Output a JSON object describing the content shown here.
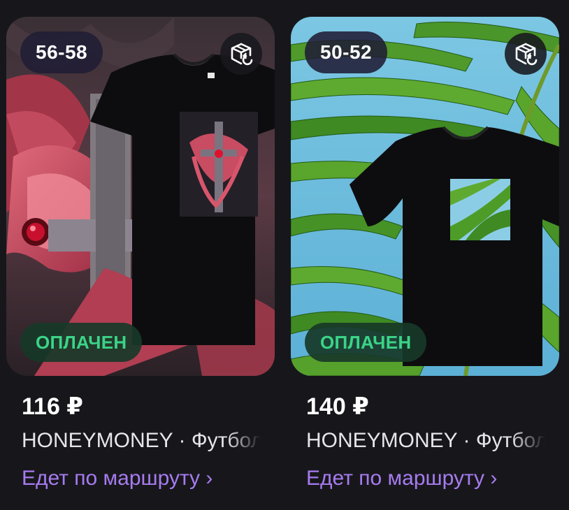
{
  "products": [
    {
      "size": "56-58",
      "status_badge": "ОПЛАЧЕН",
      "price": "116 ₽",
      "title": "HONEYMONEY · Футболка",
      "delivery_status": "Едет по маршруту ›",
      "icons": {
        "return": "box-return-icon"
      }
    },
    {
      "size": "50-52",
      "status_badge": "ОПЛАЧЕН",
      "price": "140 ₽",
      "title": "HONEYMONEY · Футболка",
      "delivery_status": "Едет по маршруту ›",
      "icons": {
        "return": "box-return-icon"
      }
    }
  ],
  "colors": {
    "background": "#17171b",
    "accent_link": "#a77bf0",
    "paid_green": "#3bd487"
  }
}
